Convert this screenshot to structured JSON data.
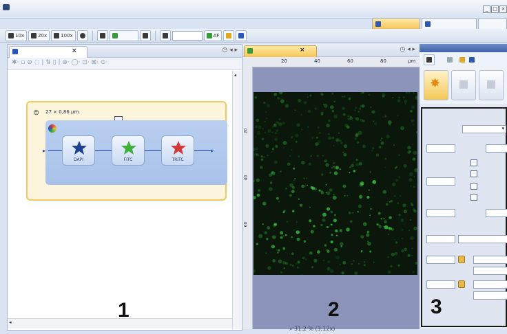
{
  "titlebar": {
    "window_buttons": [
      "_",
      "□",
      "×"
    ]
  },
  "layout_tabs": [
    {
      "active": true
    },
    {
      "active": false
    },
    {
      "active": false
    }
  ],
  "toolbar": {
    "objectives": [
      {
        "label": "10x",
        "icon": "objective-icon"
      },
      {
        "label": "20x",
        "icon": "objective-icon"
      },
      {
        "label": "100x",
        "icon": "objective-icon"
      }
    ],
    "af_label": "AF",
    "zoom_value": ""
  },
  "panel1": {
    "tab_close": "×",
    "panel_number": "1",
    "experiment": {
      "stack_label": "27 × 0,86 µm",
      "channels": [
        {
          "name": "DAPI",
          "color": "#1f3f8f"
        },
        {
          "name": "FITC",
          "color": "#3fae3a"
        },
        {
          "name": "TRITC",
          "color": "#d43a3a"
        }
      ]
    }
  },
  "panel2": {
    "tab_close": "×",
    "panel_number": "2",
    "ruler_h": [
      "20",
      "40",
      "60",
      "80",
      "µm"
    ],
    "ruler_v": [
      "20",
      "40",
      "60"
    ],
    "status_zoom": "31,2 % (3,12x)"
  },
  "panel3": {
    "panel_number": "3"
  }
}
